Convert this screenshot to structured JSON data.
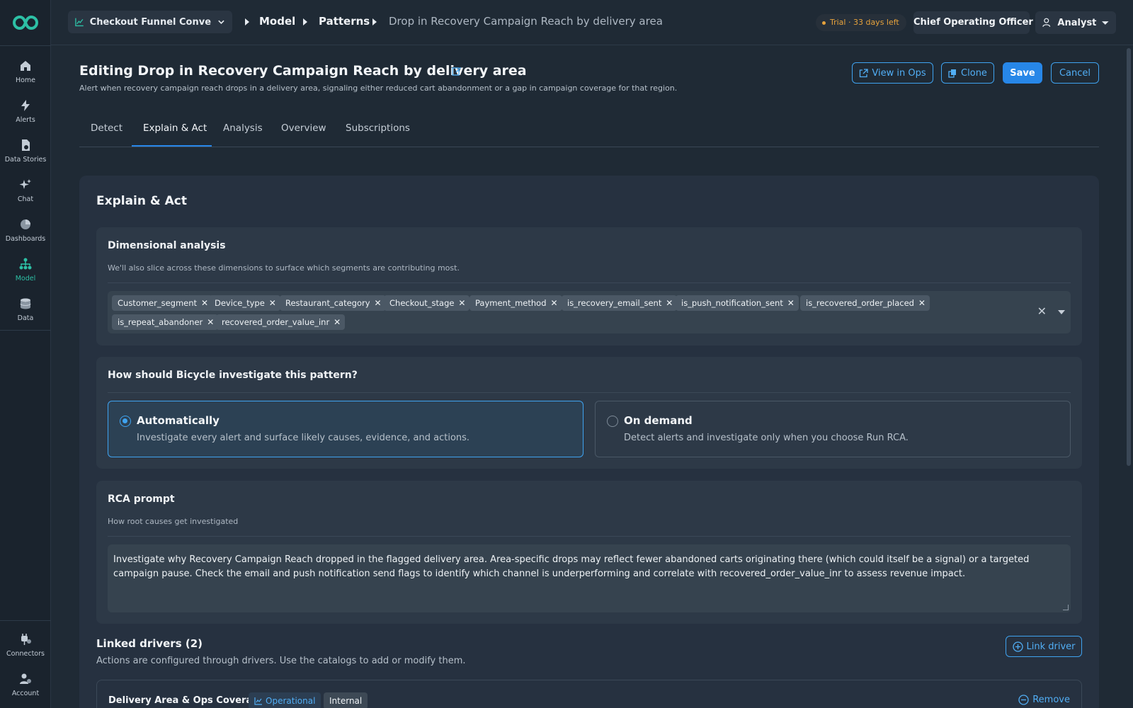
{
  "colors": {
    "brand": "#2dc0a5",
    "accent": "#2787e8",
    "link": "#51aef5",
    "trial": "#e6a23c"
  },
  "sidebar": {
    "items": [
      {
        "label": "Home",
        "icon": "home-icon"
      },
      {
        "label": "Alerts",
        "icon": "bolt-icon"
      },
      {
        "label": "Data Stories",
        "icon": "document-icon"
      },
      {
        "label": "Chat",
        "icon": "sparkle-icon"
      },
      {
        "label": "Dashboards",
        "icon": "pie-chart-icon"
      },
      {
        "label": "Model",
        "icon": "hierarchy-icon",
        "active": true
      },
      {
        "label": "Data",
        "icon": "database-icon"
      }
    ],
    "bottom": [
      {
        "label": "Connectors",
        "icon": "plug-icon"
      },
      {
        "label": "Account",
        "icon": "user-gear-icon"
      }
    ]
  },
  "topbar": {
    "workspace": "Checkout Funnel Conver...",
    "breadcrumbs": [
      "Model",
      "Patterns",
      "Drop in Recovery Campaign Reach by delivery area"
    ],
    "trial": "Trial · 33 days left",
    "role": "Chief Operating Officer",
    "user": "Analyst"
  },
  "header": {
    "title": "Editing Drop in Recovery Campaign Reach by delivery area",
    "description": "Alert when recovery campaign reach drops in a delivery area, signaling either reduced cart abandonment or a gap in campaign coverage for that region.",
    "view_in_ops": "View in Ops",
    "clone": "Clone",
    "save": "Save",
    "cancel": "Cancel"
  },
  "tabs": [
    "Detect",
    "Explain & Act",
    "Analysis",
    "Overview",
    "Subscriptions"
  ],
  "active_tab": "Explain & Act",
  "section_title": "Explain & Act",
  "dimensional": {
    "title": "Dimensional analysis",
    "subtitle": "We'll also slice across these dimensions to surface which segments are contributing most.",
    "chips": [
      "Customer_segment",
      "Device_type",
      "Restaurant_category",
      "Checkout_stage",
      "Payment_method",
      "is_recovery_email_sent",
      "is_push_notification_sent",
      "is_recovered_order_placed",
      "is_repeat_abandoner",
      "recovered_order_value_inr"
    ]
  },
  "investigate": {
    "title": "How should Bicycle investigate this pattern?",
    "options": [
      {
        "title": "Automatically",
        "desc": "Investigate every alert and surface likely causes, evidence, and actions.",
        "selected": true
      },
      {
        "title": "On demand",
        "desc": "Detect alerts and investigate only when you choose Run RCA.",
        "selected": false
      }
    ]
  },
  "rca": {
    "title": "RCA prompt",
    "subtitle": "How root causes get investigated",
    "prompt": "Investigate why Recovery Campaign Reach dropped in the flagged delivery area. Area-specific drops may reflect fewer abandoned carts originating there (which could itself be a signal) or a targeted campaign pause. Check the email and push notification send flags to identify which channel is underperforming and correlate with recovered_order_value_inr to assess revenue impact."
  },
  "drivers": {
    "title": "Linked drivers (2)",
    "subtitle": "Actions are configured through drivers. Use the catalogs to add or modify them.",
    "link_button": "Link driver",
    "items": [
      {
        "name": "Delivery Area & Ops Coverage",
        "badge": "Operational",
        "tag": "Internal",
        "remove": "Remove"
      }
    ]
  }
}
